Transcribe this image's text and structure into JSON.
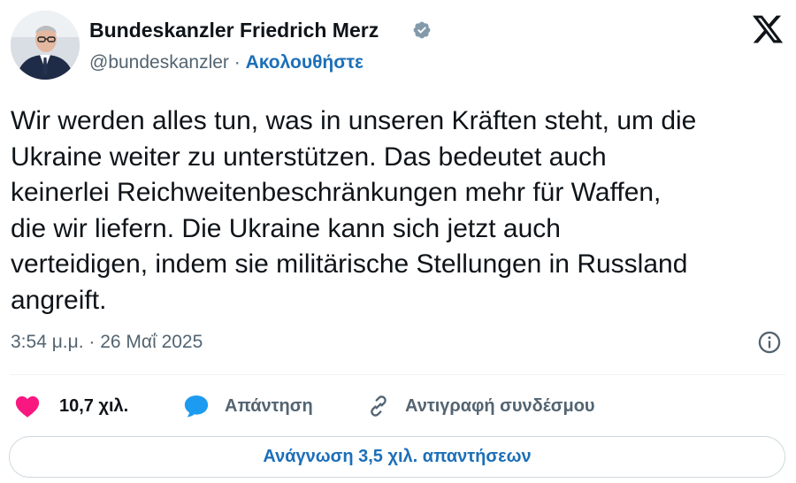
{
  "author": {
    "name": "Bundeskanzler Friedrich Merz",
    "handle": "@bundeskanzler",
    "separator": " · ",
    "follow_label": "Ακολουθήστε"
  },
  "tweet": {
    "text": "Wir werden alles tun, was in unseren Kräften steht, um die\nUkraine weiter zu unterstützen. Das bedeutet auch\nkeinerlei Reichweitenbeschränkungen mehr für Waffen,\ndie wir liefern. Die Ukraine kann sich jetzt auch\nverteidigen, indem sie militärische Stellungen in Russland\nangreift.",
    "timestamp": "3:54 μ.μ. · 26 Μαΐ 2025"
  },
  "actions": {
    "likes_count": "10,7 χιλ.",
    "reply_label": "Απάντηση",
    "copy_link_label": "Αντιγραφή συνδέσμου"
  },
  "read_replies_label": "Ανάγνωση 3,5 χιλ. απαντήσεων",
  "icons": [
    "x-logo-icon",
    "verified-badge-icon",
    "info-icon",
    "heart-icon",
    "speech-bubble-icon",
    "link-icon"
  ],
  "colors": {
    "text": "#0f1419",
    "secondary": "#536471",
    "link": "#1d6fb8",
    "like": "#f91880",
    "reply": "#1d9bf0",
    "verified": "#829aab",
    "border": "#cfd9de"
  }
}
